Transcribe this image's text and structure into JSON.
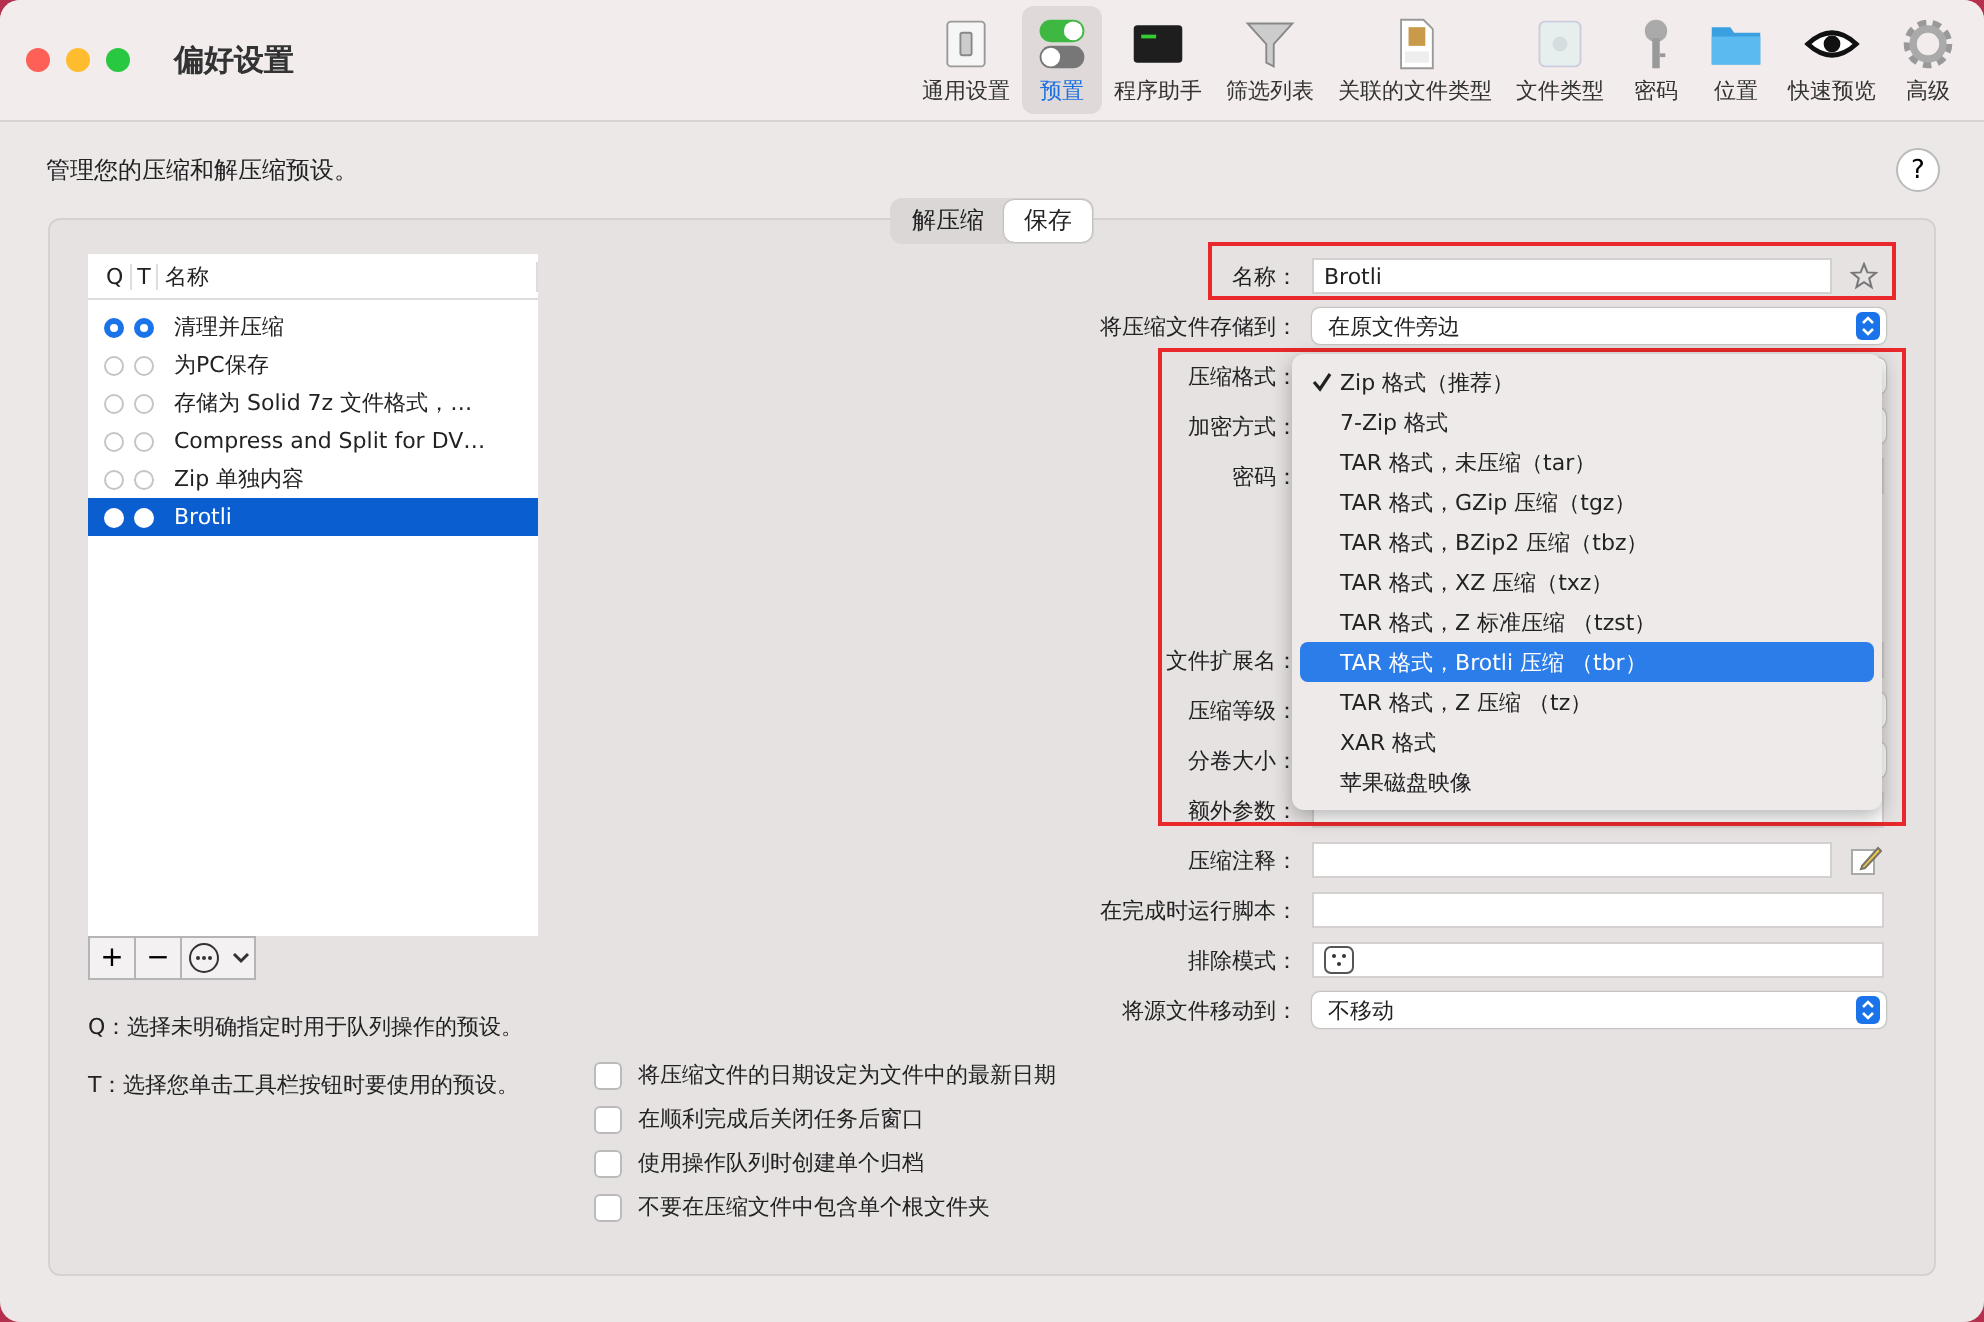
{
  "window": {
    "title": "偏好设置"
  },
  "toolbar": [
    {
      "label": "通用设置",
      "selected": false
    },
    {
      "label": "预置",
      "selected": true
    },
    {
      "label": "程序助手",
      "selected": false
    },
    {
      "label": "筛选列表",
      "selected": false
    },
    {
      "label": "关联的文件类型",
      "selected": false
    },
    {
      "label": "文件类型",
      "selected": false
    },
    {
      "label": "密码",
      "selected": false
    },
    {
      "label": "位置",
      "selected": false
    },
    {
      "label": "快速预览",
      "selected": false
    },
    {
      "label": "高级",
      "selected": false
    }
  ],
  "intro": "管理您的压缩和解压缩预设。",
  "help_button": "?",
  "segments": [
    {
      "label": "解压缩",
      "selected": false
    },
    {
      "label": "保存",
      "selected": true
    }
  ],
  "presets": {
    "columns": [
      "Q",
      "T",
      "名称"
    ],
    "rows": [
      {
        "name": "清理并压缩",
        "q": true,
        "t": true,
        "selected": false
      },
      {
        "name": "为PC保存",
        "q": false,
        "t": false,
        "selected": false
      },
      {
        "name": "存储为 Solid 7z 文件格式，…",
        "q": false,
        "t": false,
        "selected": false
      },
      {
        "name": "Compress and Split for DV…",
        "q": false,
        "t": false,
        "selected": false
      },
      {
        "name": "Zip 单独内容",
        "q": false,
        "t": false,
        "selected": false
      },
      {
        "name": "Brotli",
        "q": false,
        "t": false,
        "selected": true
      }
    ],
    "add_button": "+",
    "remove_button": "−"
  },
  "notes": [
    "Q：选择未明确指定时用于队列操作的预设。",
    "T：选择您单击工具栏按钮时要使用的预设。"
  ],
  "form": [
    {
      "label": "名称：",
      "kind": "name_field",
      "value": "Brotli"
    },
    {
      "label": "将压缩文件存储到：",
      "kind": "popup",
      "value": "在原文件旁边"
    },
    {
      "label": "压缩格式：",
      "kind": "popup"
    },
    {
      "label": "加密方式：",
      "kind": "popup"
    },
    {
      "label": "密码：",
      "kind": "password"
    },
    {
      "label": "文件扩展名：",
      "kind": "field"
    },
    {
      "label": "压缩等级：",
      "kind": "popup"
    },
    {
      "label": "分卷大小：",
      "kind": "popup"
    },
    {
      "label": "额外参数：",
      "kind": "field"
    },
    {
      "label": "压缩注释：",
      "kind": "comment_field"
    },
    {
      "label": "在完成时运行脚本：",
      "kind": "field"
    },
    {
      "label": "排除模式：",
      "kind": "pattern_field"
    },
    {
      "label": "将源文件移动到：",
      "kind": "popup",
      "value": "不移动"
    }
  ],
  "format_menu": [
    {
      "label": "Zip 格式（推荐）",
      "checked": true,
      "selected": false
    },
    {
      "label": "7-Zip 格式",
      "checked": false,
      "selected": false
    },
    {
      "label": "TAR 格式，未压缩（tar）",
      "checked": false,
      "selected": false
    },
    {
      "label": "TAR 格式，GZip 压缩（tgz）",
      "checked": false,
      "selected": false
    },
    {
      "label": "TAR 格式，BZip2 压缩（tbz）",
      "checked": false,
      "selected": false
    },
    {
      "label": "TAR 格式，XZ 压缩（txz）",
      "checked": false,
      "selected": false
    },
    {
      "label": "TAR 格式，Z 标准压缩 （tzst）",
      "checked": false,
      "selected": false
    },
    {
      "label": "TAR 格式，Brotli 压缩 （tbr）",
      "checked": false,
      "selected": true
    },
    {
      "label": "TAR 格式，Z 压缩 （tz）",
      "checked": false,
      "selected": false
    },
    {
      "label": "XAR 格式",
      "checked": false,
      "selected": false
    },
    {
      "label": "苹果磁盘映像",
      "checked": false,
      "selected": false
    }
  ],
  "options": [
    {
      "label": "将压缩文件的日期设定为文件中的最新日期",
      "checked": false
    },
    {
      "label": "在顺利完成后关闭任务后窗口",
      "checked": false
    },
    {
      "label": "使用操作队列时创建单个归档",
      "checked": false
    },
    {
      "label": "不要在压缩文件中包含单个根文件夹",
      "checked": false
    }
  ]
}
